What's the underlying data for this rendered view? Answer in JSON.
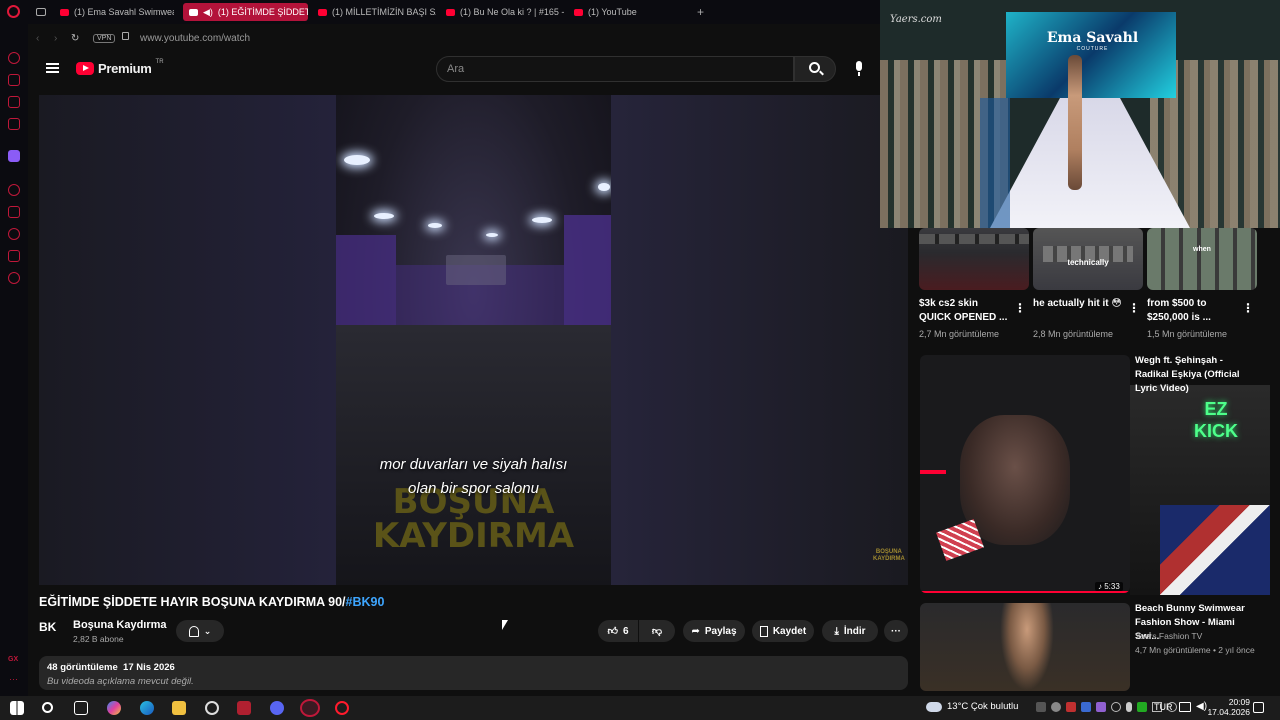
{
  "browser": {
    "tabs": [
      {
        "label": "(1) Ema Savahl Swimwear",
        "active": false
      },
      {
        "label": "(1) EĞİTİMDE ŞİDDETE",
        "active": true
      },
      {
        "label": "(1) MİLLETİMİZİN BAŞI SA",
        "active": false
      },
      {
        "label": "(1) Bu Ne Ola ki ? | #165 -",
        "active": false
      },
      {
        "label": "(1) YouTube",
        "active": false
      }
    ],
    "vpn_badge": "VPN",
    "url": "www.youtube.com/watch"
  },
  "youtube": {
    "logo_text": "Premium",
    "logo_superscript": "TR",
    "search_placeholder": "Ara",
    "accent_color": "#ff0033",
    "player": {
      "caption_line1": "mor duvarları ve siyah halısı",
      "caption_line2": "olan bir spor salonu",
      "watermark_line1": "BOŞUNA",
      "watermark_line2": "KAYDIRMA",
      "corner_watermark_line1": "BOŞUNA",
      "corner_watermark_line2": "KAYDIRMA"
    },
    "video": {
      "title": "EĞİTİMDE ŞİDDETE HAYIR BOŞUNA KAYDIRMA 90/",
      "hashtag": "#BK90",
      "channel_logo": "BK",
      "channel_name": "Boşuna Kaydırma",
      "subscribers": "2,82 B abone",
      "likes": "6",
      "share_label": "Paylaş",
      "save_label": "Kaydet",
      "download_label": "İndir",
      "views": "48 görüntüleme",
      "date": "17 Nis 2026",
      "description": "Bu videoda açıklama mevcut değil."
    },
    "shorts": [
      {
        "title": "$3k cs2 skin QUICK OPENED ...",
        "views": "2,7 Mn görüntüleme",
        "overlay": ""
      },
      {
        "title": "he actually hit it 😳",
        "views": "2,8 Mn görüntüleme",
        "overlay": "technically"
      },
      {
        "title": "from $500 to $250,000 is ...",
        "views": "1,5 Mn görüntüleme",
        "overlay": "when"
      }
    ],
    "recommended": [
      {
        "title": "Wegh ft. Şehinşah - Radikal Eşkiya (Official Lyric Video)",
        "duration": "♪ 5:33",
        "overlay_text": "EZ KICK"
      },
      {
        "title": "Beach Bunny Swimwear Fashion Show - Miami Swi...",
        "channel": "Yaers Fashion TV",
        "meta": "4,7 Mn görüntüleme • 2 yıl önce"
      }
    ]
  },
  "pip": {
    "brand_left": "Yaers.com",
    "brand_center": "Ema Savahl",
    "brand_sub": "COUTURE"
  },
  "taskbar": {
    "weather": "13°C  Çok bulutlu",
    "language": "TUR",
    "time": "20:09",
    "date": "17.04.2026"
  }
}
